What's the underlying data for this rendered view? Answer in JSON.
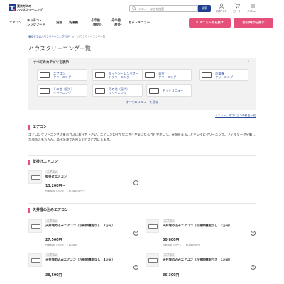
{
  "header": {
    "logo_text_line1": "東京ガスの",
    "logo_text_line2": "ハウスクリーニング",
    "search_placeholder": "メニューなどを検索",
    "search_button": "検索",
    "login": "ログイン",
    "cart": "カート",
    "menu": "メニュー"
  },
  "nav": {
    "items": [
      {
        "l1": "エアコン",
        "l2": ""
      },
      {
        "l1": "キッチン・",
        "l2": "レンジフード"
      },
      {
        "l1": "浴室",
        "l2": ""
      },
      {
        "l1": "洗濯機",
        "l2": ""
      },
      {
        "l1": "その他",
        "l2": "（屋内）"
      },
      {
        "l1": "その他",
        "l2": "（屋外）"
      },
      {
        "l1": "セットメニュー",
        "l2": ""
      }
    ],
    "btn_menu": "メニューから探す",
    "btn_date": "日時から探す"
  },
  "breadcrumb": [
    "東京ガスのハウスクリーニングTOP",
    ">",
    "ハウスクリーニング一覧"
  ],
  "page_title": "ハウスクリーニング一覧",
  "categories": {
    "heading": "すべてのカテゴリを表示",
    "items": [
      {
        "l1": "エアコン",
        "l2": "クリーニング"
      },
      {
        "l1": "キッチン・レンジフー",
        "l2": "ドクリーニング"
      },
      {
        "l1": "浴室",
        "l2": "クリーニング"
      },
      {
        "l1": "洗濯機",
        "l2": "クリーニング"
      },
      {
        "l1": "その他（屋外）",
        "l2": "クリーニング"
      },
      {
        "l1": "その他（屋内）",
        "l2": "クリーニング"
      },
      {
        "l1": "セットメニュー",
        "l2": ""
      }
    ],
    "see_all": "すべてのメニューを見る"
  },
  "price_link": "メニュー、オプションの料金一覧",
  "section_aircon": {
    "title": "エアコン",
    "intro": "エアコンクリーニングは東京ガスにお任せ下さい。エアコンのイヤなニオイや気になるカビやホコリ、花粉をまるごとキレイにクリーニング。フィルターや分解した部品はもちろん、高圧洗浄で内部までピカピカにします。"
  },
  "section_wall": {
    "title": "壁掛けエアコン",
    "items": [
      {
        "tag": "エアコン",
        "name": "壁掛けエアコン",
        "price": "13,200円〜",
        "meta": "作業時間（めやす）｜約1時間10分〜"
      }
    ]
  },
  "section_ceiling": {
    "title": "天井埋め込みエアコン",
    "items": [
      {
        "tag": "エアコン",
        "name": "天井埋め込みエアコン（お掃除機能なし・1方向）",
        "price": "27,500円",
        "meta": "作業時間（めやす）｜約2時間"
      },
      {
        "tag": "エアコン",
        "name": "天井埋め込みエアコン（お掃除機能なし・2方向）",
        "price": "30,800円",
        "meta": "作業時間（めやす）｜約2時間30分"
      },
      {
        "tag": "エアコン",
        "name": "天井埋め込みエアコン（お掃除機能なし・4方向）",
        "price": "38,500円",
        "meta": ""
      },
      {
        "tag": "エアコン",
        "name": "天井埋め込みエアコン（お掃除機能付き・1方向）",
        "price": "36,300円",
        "meta": ""
      }
    ]
  },
  "colors": {
    "accent_pink": "#e5507a",
    "nav_blue": "#1e3f8f",
    "link_blue": "#2a4a9a"
  }
}
